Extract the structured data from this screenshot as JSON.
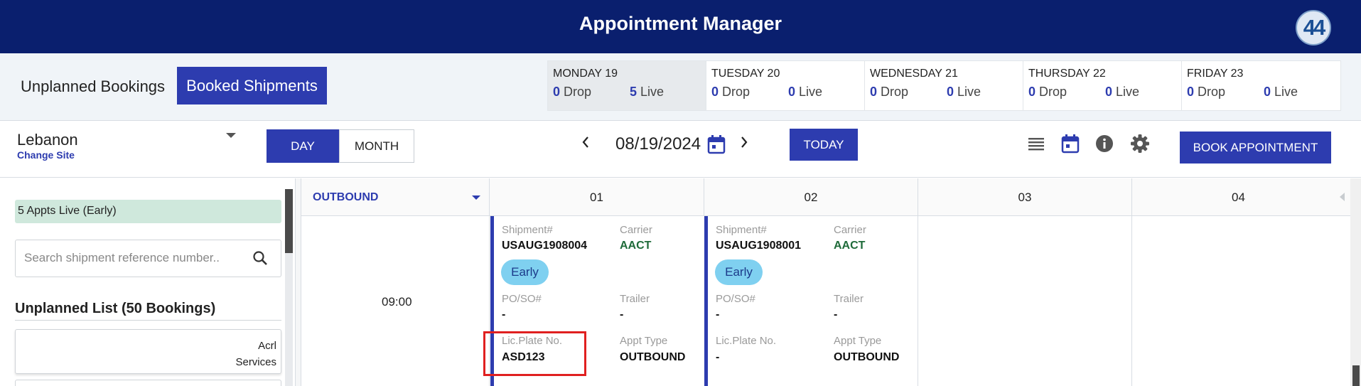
{
  "header": {
    "title": "Appointment Manager",
    "logo_text": "44"
  },
  "tabs": {
    "unplanned": "Unplanned Bookings",
    "booked": "Booked Shipments"
  },
  "days": [
    {
      "name": "MONDAY 19",
      "drop": "0",
      "drop_label": "Drop",
      "live": "5",
      "live_label": "Live"
    },
    {
      "name": "TUESDAY 20",
      "drop": "0",
      "drop_label": "Drop",
      "live": "0",
      "live_label": "Live"
    },
    {
      "name": "WEDNESDAY 21",
      "drop": "0",
      "drop_label": "Drop",
      "live": "0",
      "live_label": "Live"
    },
    {
      "name": "THURSDAY 22",
      "drop": "0",
      "drop_label": "Drop",
      "live": "0",
      "live_label": "Live"
    },
    {
      "name": "FRIDAY 23",
      "drop": "0",
      "drop_label": "Drop",
      "live": "0",
      "live_label": "Live"
    }
  ],
  "toolbar": {
    "site_name": "Lebanon",
    "change_site": "Change Site",
    "day_label": "DAY",
    "month_label": "MONTH",
    "date": "08/19/2024",
    "today_label": "TODAY",
    "book_label": "BOOK APPOINTMENT"
  },
  "left": {
    "status_chip": "5 Appts Live (Early)",
    "search_placeholder": "Search shipment reference number..",
    "unplanned_title": "Unplanned List (50 Bookings)",
    "card_line1": "Acrl",
    "card_line2": "Services"
  },
  "grid": {
    "direction": "OUTBOUND",
    "columns": [
      "01",
      "02",
      "03",
      "04"
    ],
    "time": "09:00"
  },
  "labels": {
    "shipment": "Shipment#",
    "carrier": "Carrier",
    "po": "PO/SO#",
    "trailer": "Trailer",
    "plate": "Lic.Plate No.",
    "appt_type": "Appt Type"
  },
  "appointments": [
    {
      "shipment": "USAUG1908004",
      "carrier": "AACT",
      "status": "Early",
      "po": "-",
      "trailer": "-",
      "plate": "ASD123",
      "appt_type": "OUTBOUND"
    },
    {
      "shipment": "USAUG1908001",
      "carrier": "AACT",
      "status": "Early",
      "po": "-",
      "trailer": "-",
      "plate": "-",
      "appt_type": "OUTBOUND"
    }
  ],
  "colors": {
    "navy": "#0a1f6e",
    "accent": "#2d3caf",
    "early": "#7fd0f0",
    "live_chip": "#cfe8dc",
    "highlight": "#e02020"
  },
  "icons": [
    "chevron-left-icon",
    "chevron-right-icon",
    "calendar-icon",
    "list-icon",
    "info-icon",
    "gear-icon",
    "search-icon"
  ]
}
